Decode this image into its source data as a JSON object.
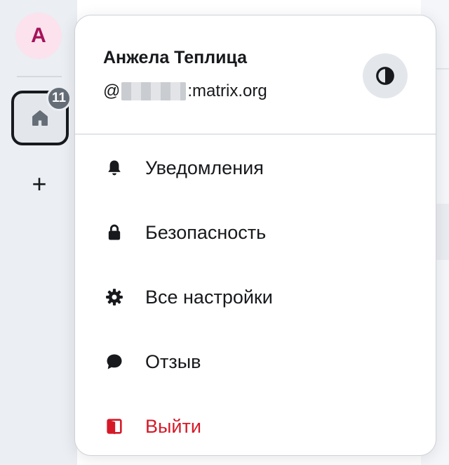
{
  "spaces": {
    "avatar_initial": "А",
    "home_badge_count": "11",
    "add_label": "+"
  },
  "user": {
    "name": "Анжела Теплица",
    "id_prefix": "@",
    "id_suffix": ":matrix.org"
  },
  "menu": {
    "items": [
      {
        "label": "Уведомления",
        "icon": "bell-icon"
      },
      {
        "label": "Безопасность",
        "icon": "lock-icon"
      },
      {
        "label": "Все настройки",
        "icon": "gear-icon"
      },
      {
        "label": "Отзыв",
        "icon": "chat-bubble-icon"
      },
      {
        "label": "Выйти",
        "icon": "sign-out-icon"
      }
    ]
  },
  "colors": {
    "danger": "#d51928",
    "avatar_text": "#a5125a",
    "avatar_bg": "#fbe2ec",
    "badge_bg": "#656d77"
  }
}
